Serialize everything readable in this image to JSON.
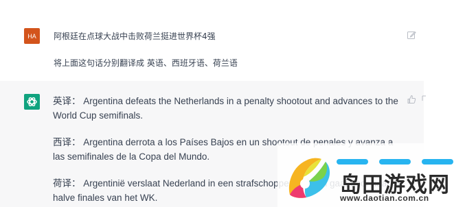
{
  "user_message": {
    "avatar_initials": "HA",
    "line1": "阿根廷在点球大战中击败荷兰挺进世界杯4强",
    "line2": "将上面这句话分别翻译成 英语、西班牙语、荷兰语"
  },
  "assistant_message": {
    "paragraphs": [
      {
        "label": "英译：",
        "text": "Argentina defeats the Netherlands in a penalty shootout and advances to the World Cup semifinals."
      },
      {
        "label": "西译：",
        "text": "Argentina derrota a los Países Bajos en un shootout de penales y avanza a las semifinales de la Copa del Mundo."
      },
      {
        "label": "荷译：",
        "text": "Argentinië verslaat Nederland in een strafschoppenserie en gaat door naar de halve finales van het WK."
      }
    ]
  },
  "icons": {
    "user_avatar": "user-avatar",
    "assistant_avatar": "openai-logo-icon",
    "edit": "edit-icon",
    "feedback": "thumbs-up-icon"
  },
  "colors": {
    "user_avatar_bg": "#d3541c",
    "assistant_avatar_bg": "#10a37f",
    "assistant_bg": "#f7f7f8",
    "text": "#374151"
  },
  "watermark": {
    "title": "岛田游戏网",
    "url": "www.daotian.com.cn"
  }
}
